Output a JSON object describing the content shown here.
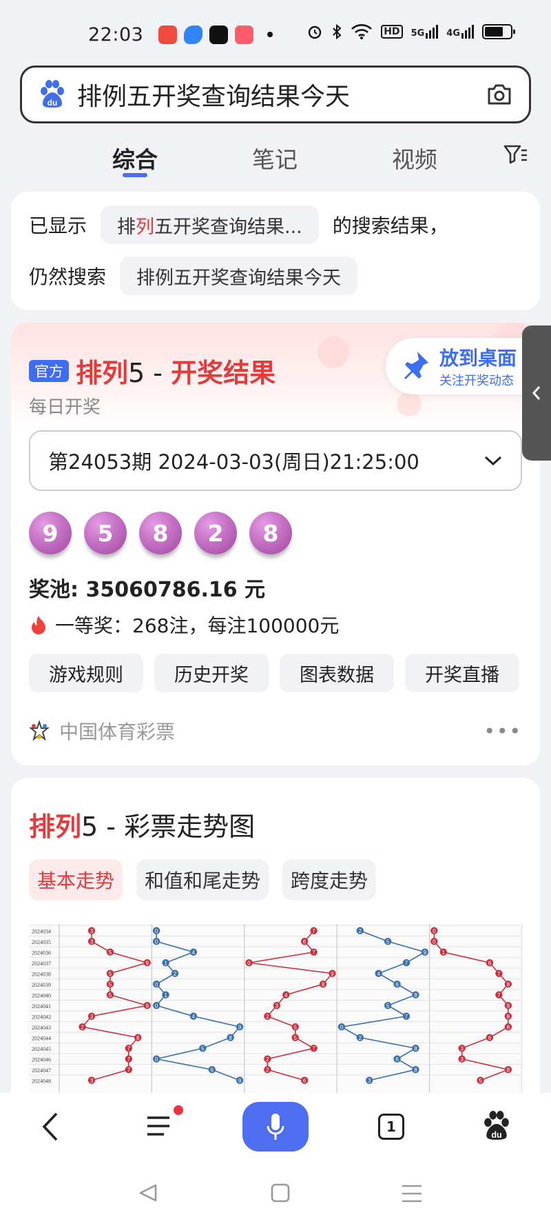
{
  "status": {
    "time": "22:03",
    "apps": [
      "#f04a3e",
      "#2f86f6",
      "#111111",
      "#ff5b6a"
    ],
    "right": [
      "alarm-icon",
      "bluetooth-icon",
      "wifi-icon",
      "HD",
      "5G",
      "4G",
      "battery-icon"
    ]
  },
  "search": {
    "query": "排例五开奖查询结果今天",
    "logo": "baidu-paw-icon",
    "camera": "camera-icon"
  },
  "tabs": [
    "综合",
    "笔记",
    "视频"
  ],
  "correction": {
    "shown_prefix": "已显示",
    "shown_pill_part1": "排",
    "shown_pill_red": "列",
    "shown_pill_part2": "五开奖查询结果...",
    "shown_suffix": "的搜索结果，",
    "still_prefix": "仍然搜索",
    "still_pill": "排例五开奖查询结果今天"
  },
  "lottery": {
    "badge": "官方",
    "title_red1": "排列",
    "title_black": "5 - ",
    "title_red2": "开奖结果",
    "subtitle": "每日开奖",
    "pin_title": "放到桌面",
    "pin_sub": "关注开奖动态",
    "draw": "第24053期 2024-03-03(周日)21:25:00",
    "numbers": [
      "9",
      "5",
      "8",
      "2",
      "8"
    ],
    "pool_label": "奖池:",
    "pool_value": "35060786.16 元",
    "first_prize": "一等奖：268注，每注100000元",
    "buttons": [
      "游戏规则",
      "历史开奖",
      "图表数据",
      "开奖直播"
    ],
    "source": "中国体育彩票"
  },
  "trend": {
    "title_red": "排列",
    "title_black": "5 - 彩票走势图",
    "tabs": [
      "基本走势",
      "和值和尾走势",
      "跨度走势"
    ],
    "periods": [
      "2024034",
      "2024035",
      "2024036",
      "2024037",
      "2024038",
      "2024039",
      "2024040",
      "2024041",
      "2024042",
      "2024043",
      "2024044",
      "2024045",
      "2024046",
      "2024047",
      "2024048"
    ],
    "col1": [
      3,
      3,
      5,
      9,
      5,
      5,
      5,
      9,
      3,
      2,
      8,
      7,
      7,
      7,
      3
    ],
    "col2": [
      0,
      0,
      4,
      1,
      2,
      0,
      1,
      0,
      4,
      9,
      8,
      5,
      0,
      6,
      9
    ],
    "col3": [
      7,
      6,
      7,
      0,
      9,
      8,
      4,
      3,
      2,
      5,
      5,
      7,
      2,
      2,
      6
    ],
    "col4": [
      2,
      5,
      9,
      7,
      4,
      6,
      8,
      5,
      7,
      0,
      2,
      8,
      6,
      8,
      3
    ],
    "col5": [
      0,
      0,
      1,
      6,
      7,
      8,
      7,
      8,
      8,
      8,
      6,
      3,
      3,
      8,
      5
    ]
  },
  "nav": [
    "back-icon",
    "menu-icon",
    "mic-icon",
    "tabs-count-icon",
    "baidu-icon"
  ],
  "tab_count": "1"
}
